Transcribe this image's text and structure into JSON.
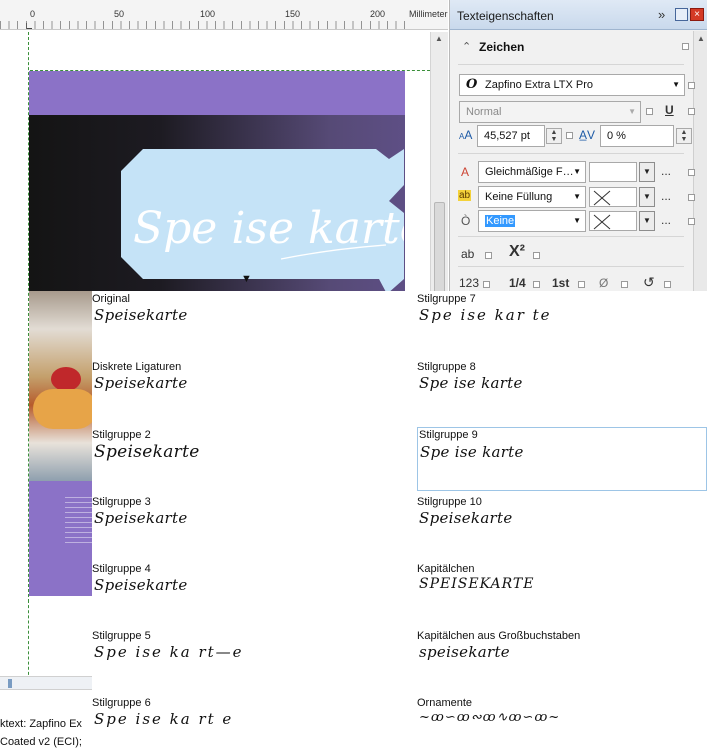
{
  "ruler": {
    "ticks": [
      "0",
      "50",
      "100",
      "150",
      "200"
    ],
    "unit": "Millimeter"
  },
  "panel": {
    "title": "Texteigenschaften",
    "more": "»",
    "section": "Zeichen",
    "font": {
      "glyph": "O",
      "name": "Zapfino Extra LTX Pro"
    },
    "style": "Normal",
    "size": "45,527 pt",
    "tracking": "0 %",
    "fill_type": "Gleichmäßige F…",
    "background_fill": "Keine Füllung",
    "outline": "Keine",
    "more_dots": "...",
    "row_icons": [
      "ab",
      "X²"
    ],
    "numeral_icons": [
      "123",
      "1/4",
      "1st",
      "Ø"
    ]
  },
  "styles": {
    "left": [
      {
        "caption": "Original",
        "sample": "Speisekarte"
      },
      {
        "caption": "Diskrete Ligaturen",
        "sample": "Speisekarte"
      },
      {
        "caption": "Stilgruppe 2",
        "sample": "Speisekarte"
      },
      {
        "caption": "Stilgruppe 3",
        "sample": "Speisekarte"
      },
      {
        "caption": "Stilgruppe 4",
        "sample": "Speisekarte"
      },
      {
        "caption": "Stilgruppe 5",
        "sample": "Spe ise ka rt—e"
      },
      {
        "caption": "Stilgruppe 6",
        "sample": "Spe ise ka rt e"
      }
    ],
    "right": [
      {
        "caption": "Stilgruppe 7",
        "sample": "Spe ise kar te"
      },
      {
        "caption": "Stilgruppe 8",
        "sample": "Spe ise karte"
      },
      {
        "caption": "Stilgruppe 9",
        "sample": "Spe ise karte"
      },
      {
        "caption": "Stilgruppe 10",
        "sample": "Speisekarte"
      },
      {
        "caption": "Kapitälchen",
        "sample": "SPEISEKARTE"
      },
      {
        "caption": "Kapitälchen aus Großbuchstaben",
        "sample": "speisekarte"
      },
      {
        "caption": "Ornamente",
        "sample": "~ꝏ∽ꝏ∾ꝏ∿ꝏ∽ꝏ~"
      }
    ]
  },
  "design": {
    "headline": "Spe ise karte"
  },
  "status": {
    "line1": "ktext: Zapfino Ex",
    "line2": "Coated v2 (ECI);"
  },
  "colors": {
    "accent": "#8b72c7",
    "bubble": "#c5e3f7",
    "selection": "#3399ff"
  }
}
